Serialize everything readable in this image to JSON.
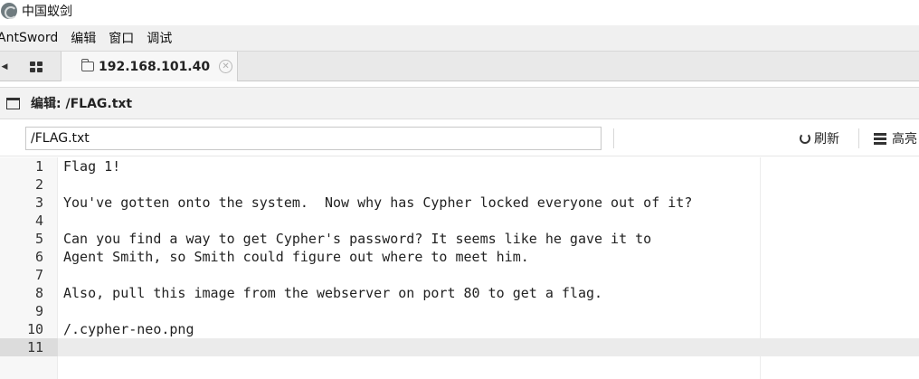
{
  "window": {
    "title": "中国蚁剑"
  },
  "menu": [
    "AntSword",
    "编辑",
    "窗口",
    "调试"
  ],
  "tabs": {
    "active_label": "192.168.101.40"
  },
  "panel": {
    "title": "编辑: /FLAG.txt"
  },
  "toolbar": {
    "path_value": "/FLAG.txt",
    "refresh_label": "刷新",
    "highlight_label": "高亮"
  },
  "editor": {
    "lines": [
      "Flag 1!",
      "",
      "You've gotten onto the system.  Now why has Cypher locked everyone out of it?",
      "",
      "Can you find a way to get Cypher's password? It seems like he gave it to",
      "Agent Smith, so Smith could figure out where to meet him.",
      "",
      "Also, pull this image from the webserver on port 80 to get a flag.",
      "",
      "/.cypher-neo.png",
      ""
    ],
    "line_numbers": [
      "1",
      "2",
      "3",
      "4",
      "5",
      "6",
      "7",
      "8",
      "9",
      "10",
      "11"
    ],
    "active_line": 11
  }
}
